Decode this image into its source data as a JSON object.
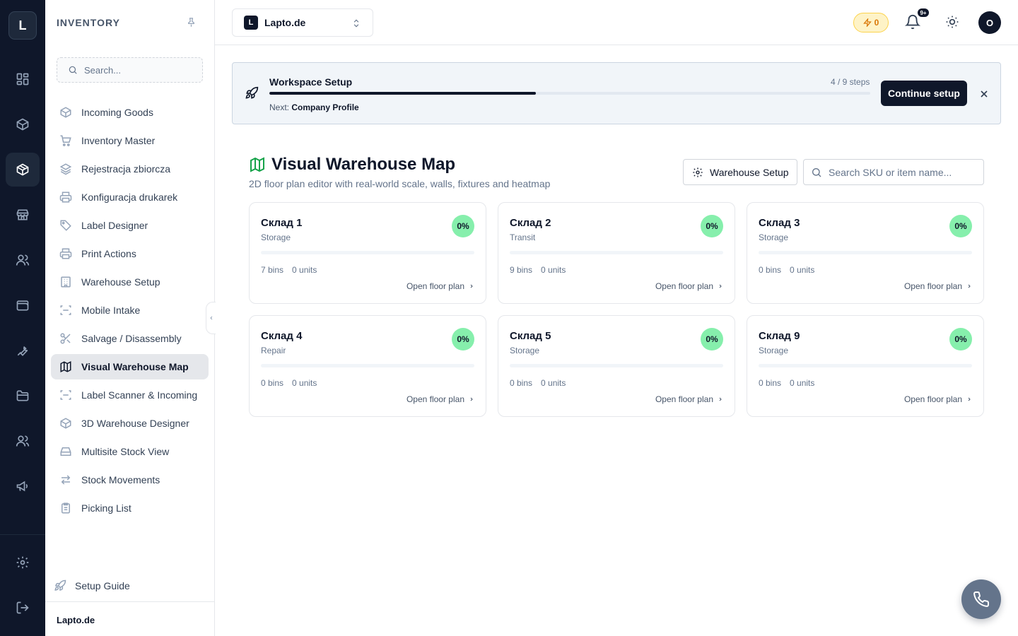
{
  "rail": {
    "logo": "L"
  },
  "sidebar": {
    "title": "INVENTORY",
    "search_placeholder": "Search...",
    "items": [
      {
        "label": "Incoming Goods",
        "icon": "package-in-icon"
      },
      {
        "label": "Inventory Master",
        "icon": "cart-icon"
      },
      {
        "label": "Rejestracja zbiorcza",
        "icon": "layers-icon"
      },
      {
        "label": "Konfiguracja drukarek",
        "icon": "printer-icon"
      },
      {
        "label": "Label Designer",
        "icon": "tag-icon"
      },
      {
        "label": "Print Actions",
        "icon": "printer-icon"
      },
      {
        "label": "Warehouse Setup",
        "icon": "building-icon"
      },
      {
        "label": "Mobile Intake",
        "icon": "scan-icon"
      },
      {
        "label": "Salvage / Disassembly",
        "icon": "scissors-icon"
      },
      {
        "label": "Visual Warehouse Map",
        "icon": "map-icon",
        "active": true
      },
      {
        "label": "Label Scanner & Incoming",
        "icon": "scan-icon"
      },
      {
        "label": "3D Warehouse Designer",
        "icon": "box-icon"
      },
      {
        "label": "Multisite Stock View",
        "icon": "hard-drive-icon"
      },
      {
        "label": "Stock Movements",
        "icon": "arrows-icon"
      },
      {
        "label": "Picking List",
        "icon": "clipboard-icon"
      }
    ],
    "setup_guide": "Setup Guide",
    "footer": "Lapto.de"
  },
  "topbar": {
    "workspace_badge": "L",
    "workspace_name": "Lapto.de",
    "credits": "0",
    "notifications_badge": "9+",
    "avatar": "O"
  },
  "setup": {
    "title": "Workspace Setup",
    "steps": "4 / 9 steps",
    "progress": 0.444,
    "next_label": "Next:",
    "next_value": "Company Profile",
    "button": "Continue setup"
  },
  "page": {
    "title": "Visual Warehouse Map",
    "subtitle": "2D floor plan editor with real-world scale, walls, fixtures and heatmap",
    "setup_button": "Warehouse Setup",
    "search_placeholder": "Search SKU or item name..."
  },
  "warehouses": [
    {
      "name": "Склад 1",
      "type": "Storage",
      "pct": "0%",
      "bins": "7 bins",
      "units": "0 units",
      "link": "Open floor plan"
    },
    {
      "name": "Склад 2",
      "type": "Transit",
      "pct": "0%",
      "bins": "9 bins",
      "units": "0 units",
      "link": "Open floor plan"
    },
    {
      "name": "Склад 3",
      "type": "Storage",
      "pct": "0%",
      "bins": "0 bins",
      "units": "0 units",
      "link": "Open floor plan"
    },
    {
      "name": "Склад 4",
      "type": "Repair",
      "pct": "0%",
      "bins": "0 bins",
      "units": "0 units",
      "link": "Open floor plan"
    },
    {
      "name": "Склад 5",
      "type": "Storage",
      "pct": "0%",
      "bins": "0 bins",
      "units": "0 units",
      "link": "Open floor plan"
    },
    {
      "name": "Склад 9",
      "type": "Storage",
      "pct": "0%",
      "bins": "0 bins",
      "units": "0 units",
      "link": "Open floor plan"
    }
  ],
  "colors": {
    "accent": "#0f172a",
    "rail": "#0f172a",
    "success": "#86efac",
    "credits": "#d97706"
  }
}
